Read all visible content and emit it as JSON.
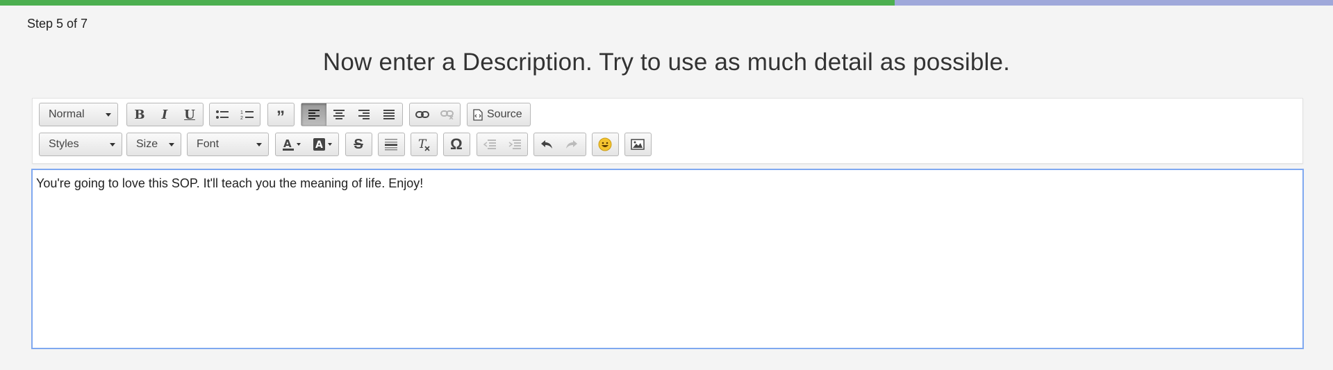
{
  "progress": {
    "current_step": 5,
    "total_steps": 7,
    "fraction": 0.671,
    "fill_color": "#4caf50",
    "track_color": "#9fa8da"
  },
  "step_label": "Step 5 of 7",
  "page_title": "Now enter a Description. Try to use as much detail as possible.",
  "toolbar": {
    "format_combo": "Normal",
    "styles_combo": "Styles",
    "size_combo": "Size",
    "font_combo": "Font",
    "source_label": "Source",
    "icons": {
      "bold": "bold-icon",
      "italic": "italic-icon",
      "underline": "underline-icon",
      "bulleted_list": "bulleted-list-icon",
      "numbered_list": "numbered-list-icon",
      "blockquote": "blockquote-icon",
      "align_left": "align-left-icon",
      "align_center": "align-center-icon",
      "align_right": "align-right-icon",
      "justify": "justify-icon",
      "link": "link-icon",
      "unlink": "unlink-icon",
      "source": "source-icon",
      "text_color": "text-color-icon",
      "background_color": "background-color-icon",
      "strike": "strikethrough-icon",
      "horizontal_line": "horizontal-line-icon",
      "remove_format": "remove-format-icon",
      "special_char": "omega-icon",
      "outdent": "outdent-icon",
      "indent": "indent-icon",
      "undo": "undo-icon",
      "redo": "redo-icon",
      "smiley": "smiley-icon",
      "image": "image-icon"
    },
    "active_button": "align_left",
    "disabled_buttons": [
      "unlink",
      "outdent",
      "indent",
      "redo"
    ]
  },
  "editor": {
    "content": "You're going to love this SOP. It'll teach you the meaning of life. Enjoy!",
    "border_color": "#7fa8f0"
  }
}
